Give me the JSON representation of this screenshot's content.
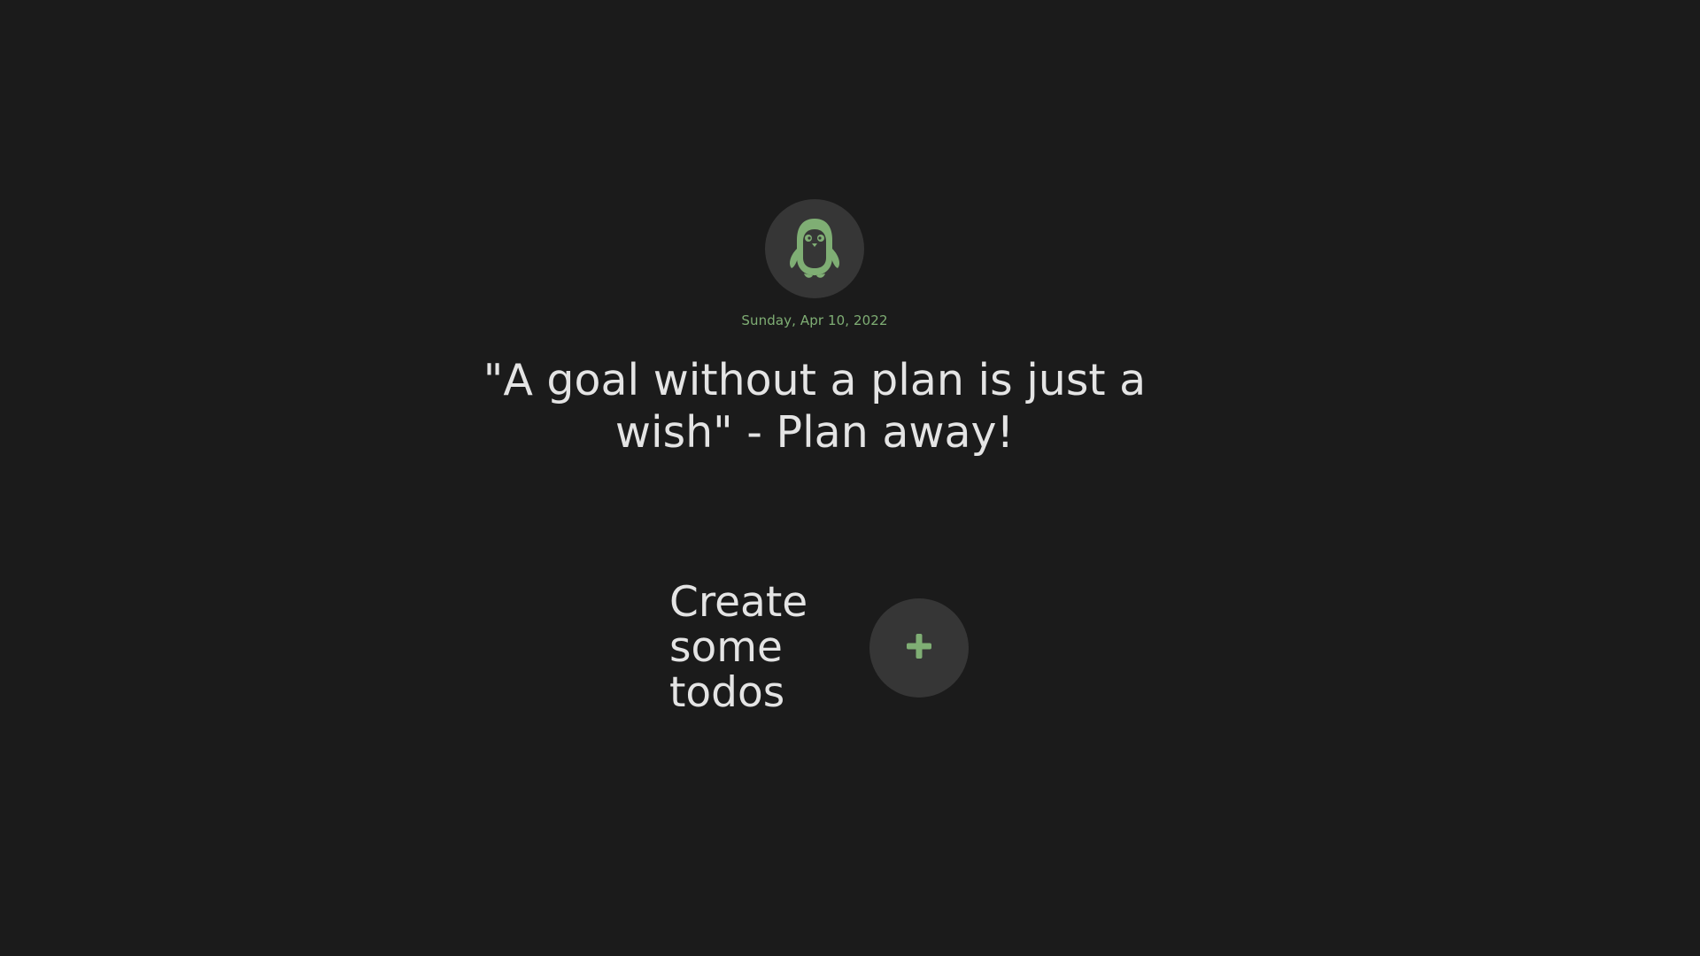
{
  "header": {
    "avatar_icon": "penguin-icon",
    "date": "Sunday, Apr 10, 2022",
    "quote": "\"A goal without a plan is just a wish\" - Plan away!"
  },
  "empty_state": {
    "text": "Create some todos",
    "add_icon": "plus-icon"
  },
  "colors": {
    "background": "#1b1b1b",
    "circle": "#363636",
    "accent": "#7fae74",
    "text": "#e4e4e4"
  }
}
